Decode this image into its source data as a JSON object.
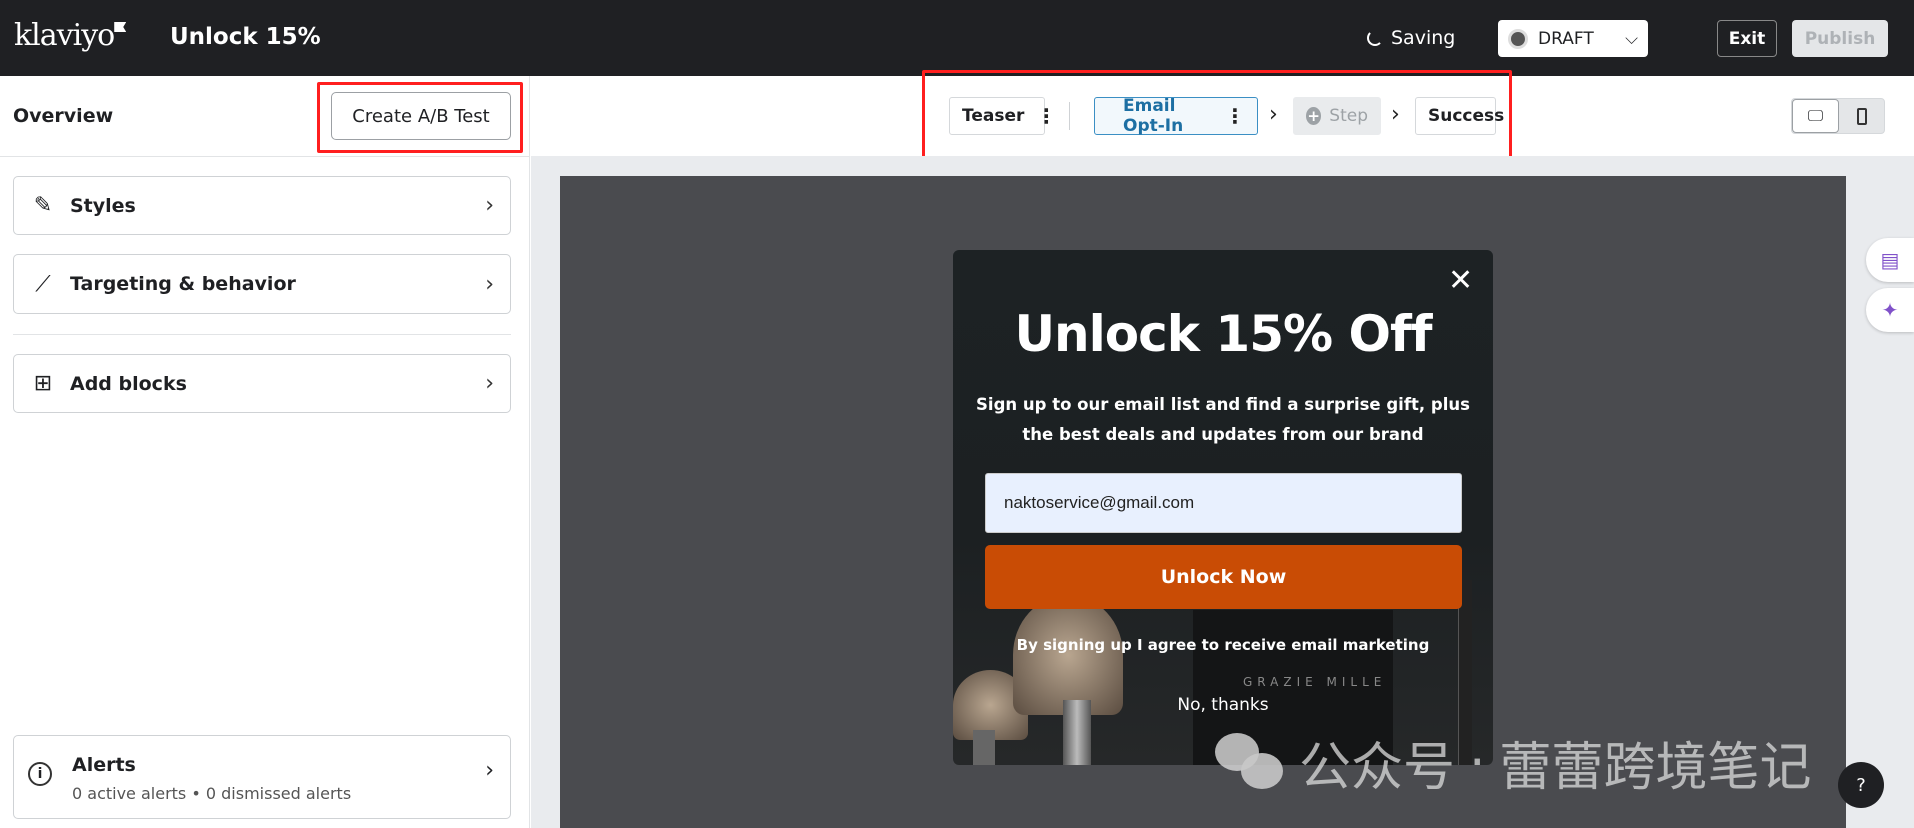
{
  "header": {
    "logo": "klaviyo",
    "title": "Unlock 15%",
    "status": "Saving",
    "draft_label": "DRAFT",
    "exit_label": "Exit",
    "publish_label": "Publish"
  },
  "sidebar": {
    "title": "Overview",
    "ab_test_label": "Create A/B Test",
    "items": [
      {
        "label": "Styles",
        "icon": "pencil-icon"
      },
      {
        "label": "Targeting & behavior",
        "icon": "magic-wand-icon"
      },
      {
        "label": "Add blocks",
        "icon": "grid-icon"
      }
    ],
    "alerts": {
      "title": "Alerts",
      "summary": "0 active alerts • 0 dismissed alerts"
    }
  },
  "steps": {
    "teaser": "Teaser",
    "email_optin": "Email Opt-In",
    "add_step": "Step",
    "success": "Success"
  },
  "popup": {
    "title": "Unlock 15% Off",
    "subtitle": "Sign up to our email list and find a surprise gift, plus the best deals and updates from our brand",
    "email_value": "naktoservice@gmail.com",
    "button_label": "Unlock Now",
    "consent": "By signing up I agree to receive email marketing",
    "decline": "No, thanks",
    "image_brand": "GRAZIE MILLE"
  },
  "watermark": {
    "text1": "公众号",
    "dot": "·",
    "text2": "蕾蕾跨境笔记"
  },
  "help_label": "?",
  "colors": {
    "header_bg": "#1f2023",
    "cta": "#c94c05",
    "active_step": "#1d6fa3",
    "highlight": "#ff1f1f",
    "ai_accent": "#8051c9"
  }
}
